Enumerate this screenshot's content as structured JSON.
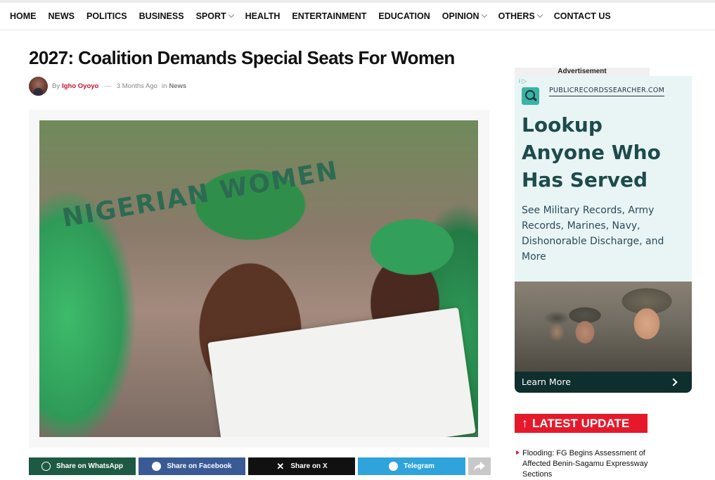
{
  "nav": {
    "items": [
      {
        "label": "HOME",
        "dropdown": false
      },
      {
        "label": "NEWS",
        "dropdown": false
      },
      {
        "label": "POLITICS",
        "dropdown": false
      },
      {
        "label": "BUSINESS",
        "dropdown": false
      },
      {
        "label": "SPORT",
        "dropdown": true
      },
      {
        "label": "HEALTH",
        "dropdown": false
      },
      {
        "label": "ENTERTAINMENT",
        "dropdown": false
      },
      {
        "label": "EDUCATION",
        "dropdown": false
      },
      {
        "label": "OPINION",
        "dropdown": true
      },
      {
        "label": "OTHERS",
        "dropdown": true
      },
      {
        "label": "CONTACT US",
        "dropdown": false
      }
    ]
  },
  "article": {
    "title": "2027: Coalition Demands Special Seats For Women",
    "by_label": "By",
    "author": "Igho Oyoyo",
    "dash": "—",
    "time": "3 Months Ago",
    "in_label": "in",
    "category": "News",
    "image_banner_text": "NIGERIAN WOMEN"
  },
  "share": {
    "whatsapp": "Share on WhatsApp",
    "facebook": "Share on Facebook",
    "x": "Share on X",
    "telegram": "Telegram"
  },
  "ad": {
    "label": "Advertisement",
    "adchoices": "i ▷",
    "domain": "PUBLICRECORDSSEARCHER.COM",
    "headline": "Lookup Anyone Who Has Served",
    "body": "See Military Records, Army Records, Marines, Navy, Dishonorable Discharge, and More",
    "cta": "Learn More"
  },
  "sidebar": {
    "latest_title": "LATEST UPDATE",
    "items": [
      "Flooding: FG Begins Assessment of Affected Benin-Sagamu Expressway Sections"
    ]
  },
  "colors": {
    "accent_red": "#e6192b",
    "author_red": "#c8102e",
    "whatsapp": "#1e5a43",
    "facebook": "#3a5a96",
    "x": "#111111",
    "telegram": "#2ea3dc",
    "ad_bg": "#e9f5f5",
    "ad_headline": "#1e4b4b"
  }
}
